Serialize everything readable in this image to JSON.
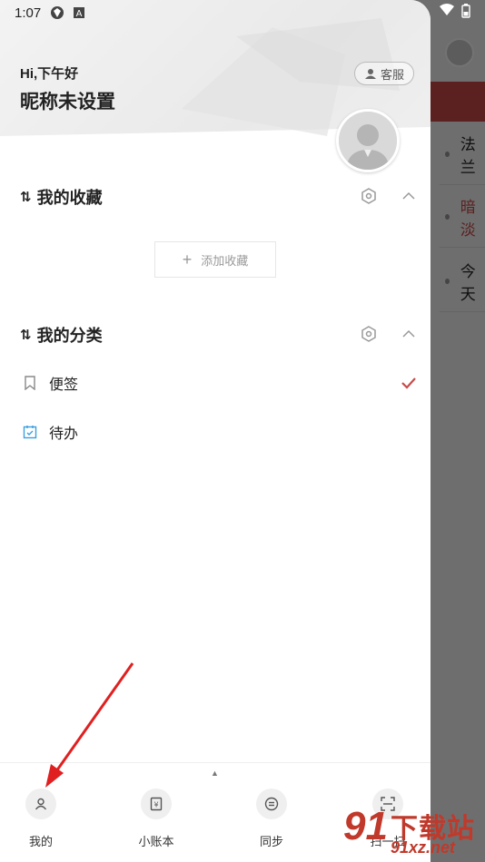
{
  "status_bar": {
    "time": "1:07"
  },
  "background_app": {
    "items": [
      "法兰",
      "暗淡",
      "今天"
    ]
  },
  "drawer": {
    "greeting": "Hi,下午好",
    "nickname": "昵称未设置",
    "service_label": "客服",
    "favorites": {
      "title": "我的收藏",
      "sort_glyph": "⇅",
      "add_label": "添加收藏"
    },
    "categories": {
      "title": "我的分类",
      "sort_glyph": "⇅",
      "items": [
        {
          "label": "便签",
          "selected": true,
          "icon": "bookmark-icon"
        },
        {
          "label": "待办",
          "selected": false,
          "icon": "calendar-check-icon"
        }
      ]
    }
  },
  "bottom_bar": {
    "tabs": [
      {
        "label": "我的",
        "icon": "person-icon"
      },
      {
        "label": "小账本",
        "icon": "ledger-icon"
      },
      {
        "label": "同步",
        "icon": "sync-icon"
      },
      {
        "label": "扫一扫",
        "icon": "scan-icon"
      }
    ]
  },
  "watermark": {
    "glyph": "91",
    "text": "下载站",
    "url": "91xz.net"
  },
  "colors": {
    "accent_red": "#c94a4a",
    "todo_blue": "#3a9fe0",
    "arrow_red": "#e02020"
  }
}
